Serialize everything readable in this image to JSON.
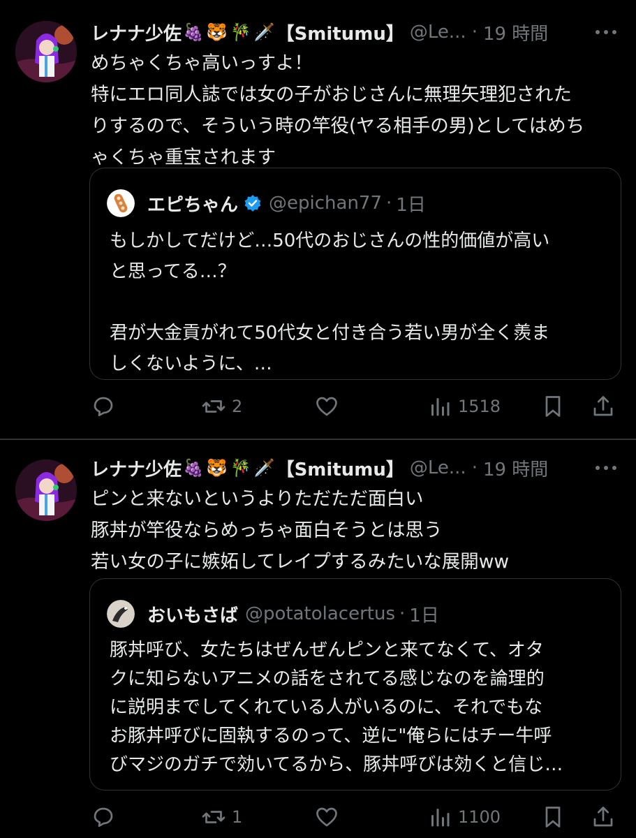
{
  "tweets": [
    {
      "author_name": "レナナ少佐",
      "emojis": [
        "🍇",
        "🐯",
        "🎋",
        "🗡️"
      ],
      "author_suffix": "【Smitumu】",
      "handle": "@Le...",
      "dot": "·",
      "time": "19 時間",
      "text_lines": [
        "めちゃくちゃ高いっすよ！",
        "特にエロ同人誌では女の子がおじさんに無理矢理犯された",
        "りするので、そういう時の竿役(ヤる相手の男)としてはめち",
        "ゃくちゃ重宝されます"
      ],
      "quote": {
        "name": "エピちゃん",
        "verified": true,
        "handle": "@epichan77",
        "dot": "·",
        "time": "1日",
        "text_lines": [
          "もしかしてだけど…50代のおじさんの性的価値が高い",
          "と思ってる…？",
          "",
          "君が大金貢がれて50代女と付き合う若い男が全く羨ま",
          "しくないように、…"
        ]
      },
      "actions": {
        "reply": "",
        "retweet": "2",
        "like": "",
        "views": "1518"
      }
    },
    {
      "author_name": "レナナ少佐",
      "emojis": [
        "🍇",
        "🐯",
        "🎋",
        "🗡️"
      ],
      "author_suffix": "【Smitumu】",
      "handle": "@Le...",
      "dot": "·",
      "time": "19 時間",
      "text_lines": [
        "ピンと来ないというよりただただ面白い",
        "豚丼が竿役ならめっちゃ面白そうとは思う",
        "若い女の子に嫉妬してレイプするみたいな展開ww"
      ],
      "quote": {
        "name": "おいもさば",
        "verified": false,
        "handle": "@potatolacertus",
        "dot": "·",
        "time": "1日",
        "text_lines": [
          "豚丼呼び、女たちはぜんぜんピンと来てなくて、オタ",
          "クに知らないアニメの話をされてる感じなのを論理的",
          "に説明までしてくれている人がいるのに、それでもな",
          "お豚丼呼びに固執するのって、逆に\"俺らにはチー牛呼",
          "びマジのガチで効いてるから、豚丼呼びは効くと信じ…"
        ]
      },
      "actions": {
        "reply": "",
        "retweet": "1",
        "like": "",
        "views": "1100"
      }
    }
  ],
  "colors": {
    "background": "#000000",
    "text": "#e7e9ea",
    "muted": "#71767b",
    "border": "#2f3336",
    "verified": "#1d9bf0"
  },
  "icons": [
    "reply-icon",
    "retweet-icon",
    "like-icon",
    "views-icon",
    "bookmark-icon",
    "share-icon",
    "more-icon",
    "verified-icon"
  ]
}
